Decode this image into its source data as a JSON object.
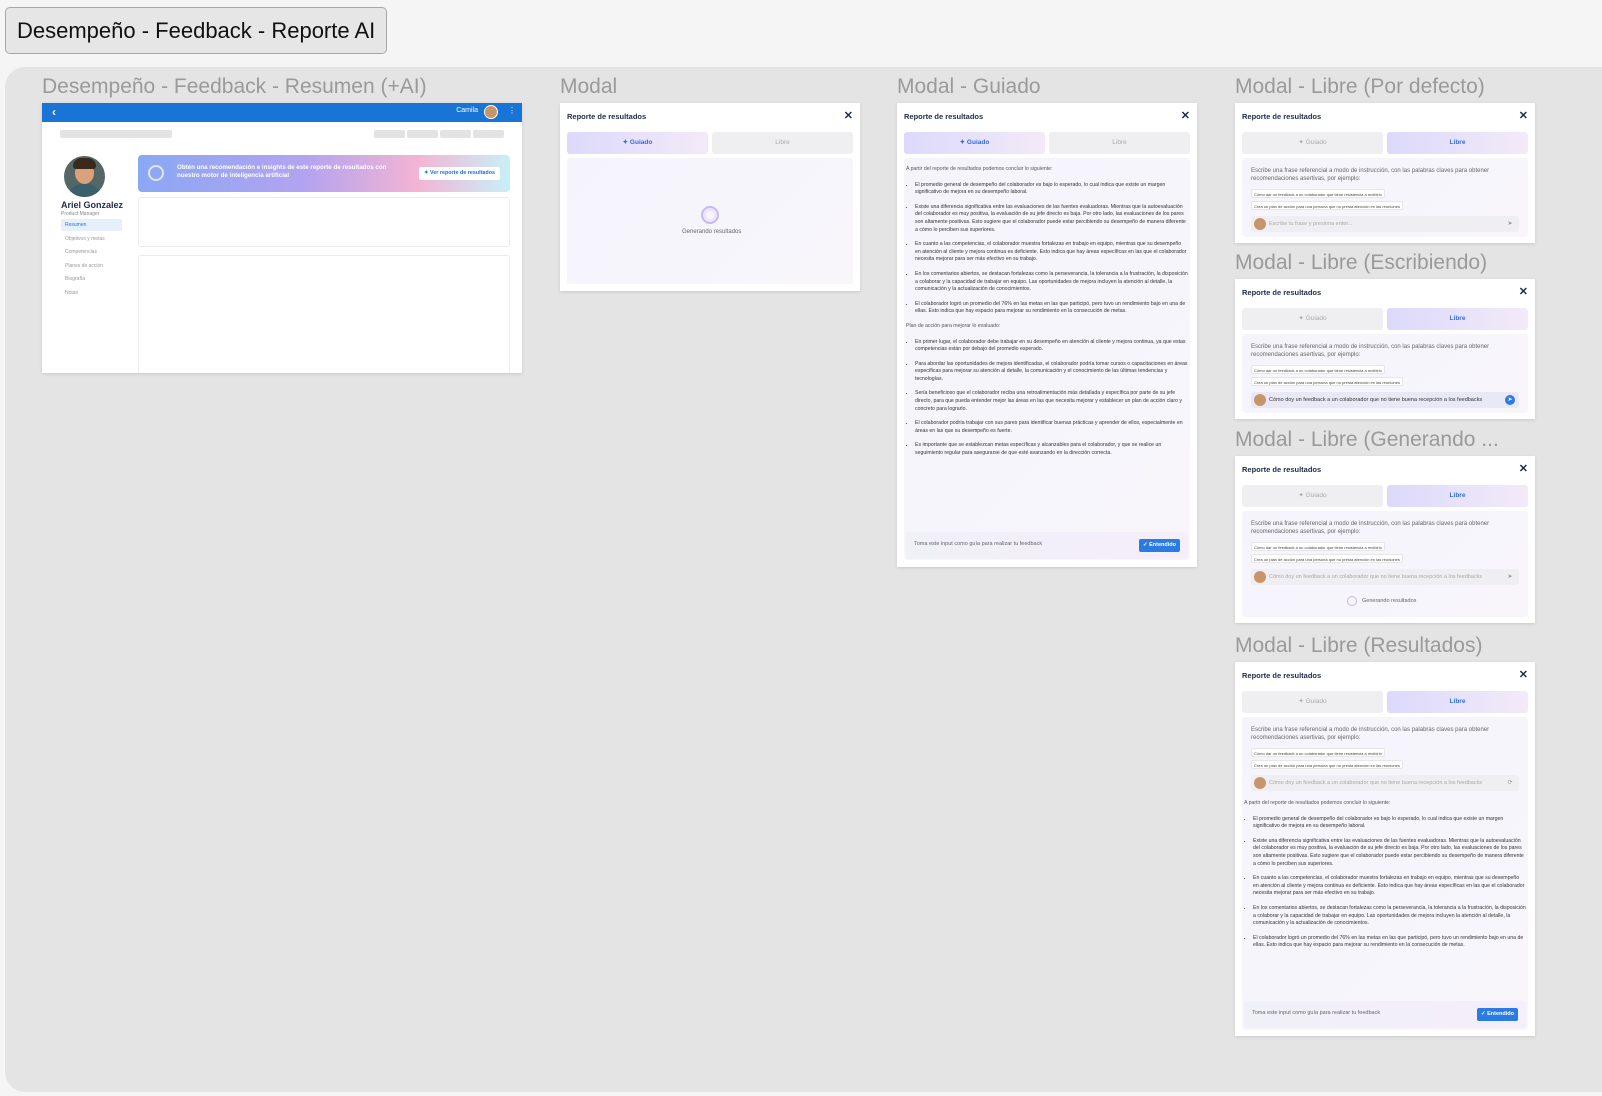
{
  "page_title": "Desempeño - Feedback - Reporte AI",
  "labels": {
    "resumen": "Desempeño - Feedback - Resumen (+AI)",
    "modal": "Modal",
    "guiado": "Modal - Guiado",
    "libre_default": "Modal - Libre (Por defecto)",
    "libre_escribiendo": "Modal - Libre (Escribiendo)",
    "libre_generando": "Modal - Libre (Generando ...",
    "libre_resultados": "Modal - Libre (Resultados)"
  },
  "app": {
    "back": "‹",
    "user": "Camila",
    "menu": "⋮",
    "profile_name": "Ariel Gonzalez",
    "profile_role": "Product Manager",
    "nav": [
      "Resumen",
      "Objetivos y metas",
      "Competencias",
      "Planes de acción",
      "Biografía",
      "Notas"
    ],
    "banner_text": "Obtén una recomendación e insights de este reporte de resultados con nuestro motor de inteligencia artificial",
    "banner_button": "✦ Ver reporte de resultados"
  },
  "modal": {
    "title": "Reporte de resultados",
    "close": "✕",
    "tab_guiado": "✦ Guiado",
    "tab_libre": "Libre",
    "generating": "Generando resultados",
    "hint": "Escribe una frase referencial a modo de instrucción, con las palabras claves para obtener recomendaciones asertivas, por ejemplo:",
    "chip1": "Cómo dar un feedback a un colaborador que tiene resistencia a recibirlo",
    "chip2": "Crea un plan de acción para una persona que no presta atención en las reuniones",
    "input_placeholder": "Escribe tu frase y presiona enter...",
    "input_typed": "Cómo doy un feedback a un colaborador que no tiene buena recepción a los feedbacks",
    "send": "➤",
    "refresh": "⟳",
    "result_lead": "A partir del reporte de resultados podemos concluir lo siguiente:",
    "plan_lead": "Plan de acción para mejorar lo evaluado:",
    "bullets": [
      "El promedio general de desempeño del colaborador es bajo lo esperado, lo cual indica que existe un margen significativo de mejora en su desempeño laboral.",
      "Existe una diferencia significativa entre las evaluaciones de las fuentes evaluadoras. Mientras que la autoevaluación del colaborador es muy positiva, la evaluación de su jefe directo es baja. Por otro lado, las evaluaciones de los pares son altamente positivas. Esto sugiere que el colaborador puede estar percibiendo su desempeño de manera diferente a cómo lo perciben sus superiores.",
      "En cuanto a las competencias, el colaborador muestra fortalezas en trabajo en equipo, mientras que su desempeño en atención al cliente y mejora continua es deficiente. Esto indica que hay áreas específicas en las que el colaborador necesita mejorar para ser más efectivo en su trabajo.",
      "En los comentarios abiertos, se destacan fortalezas como la perseverancia, la tolerancia a la frustración, la disposición a colaborar y la capacidad de trabajar en equipo. Las oportunidades de mejora incluyen la atención al detalle, la comunicación y la actualización de conocimientos.",
      "El colaborador logró un promedio del 76% en las metas en las que participó, pero tuvo un rendimiento bajo en una de ellas. Esto indica que hay espacio para mejorar su rendimiento en la consecución de metas."
    ],
    "plan": [
      "En primer lugar, el colaborador debe trabajar en su desempeño en atención al cliente y mejora continua, ya que estas competencias están por debajo del promedio esperado.",
      "Para abordar las oportunidades de mejora identificadas, el colaborador podría tomar cursos o capacitaciones en áreas específicas para mejorar su atención al detalle, la comunicación y el conocimiento de las últimas tendencias y tecnologías.",
      "Sería beneficioso que el colaborador reciba una retroalimentación más detallada y específica por parte de su jefe directo, para que pueda entender mejor las áreas en las que necesita mejorar y establecer un plan de acción claro y concreto para lograrlo.",
      "El colaborador podría trabajar con sus pares para identificar buenas prácticas y aprender de ellos, especialmente en áreas en las que su desempeño es fuerte.",
      "Es importante que se establezcan metas específicas y alcanzables para el colaborador, y que se realice un seguimiento regular para asegurarse de que esté avanzando en la dirección correcta."
    ],
    "footer_text": "Toma este input como guía para realizar tu feedback",
    "footer_button": "✓ Entendido"
  }
}
